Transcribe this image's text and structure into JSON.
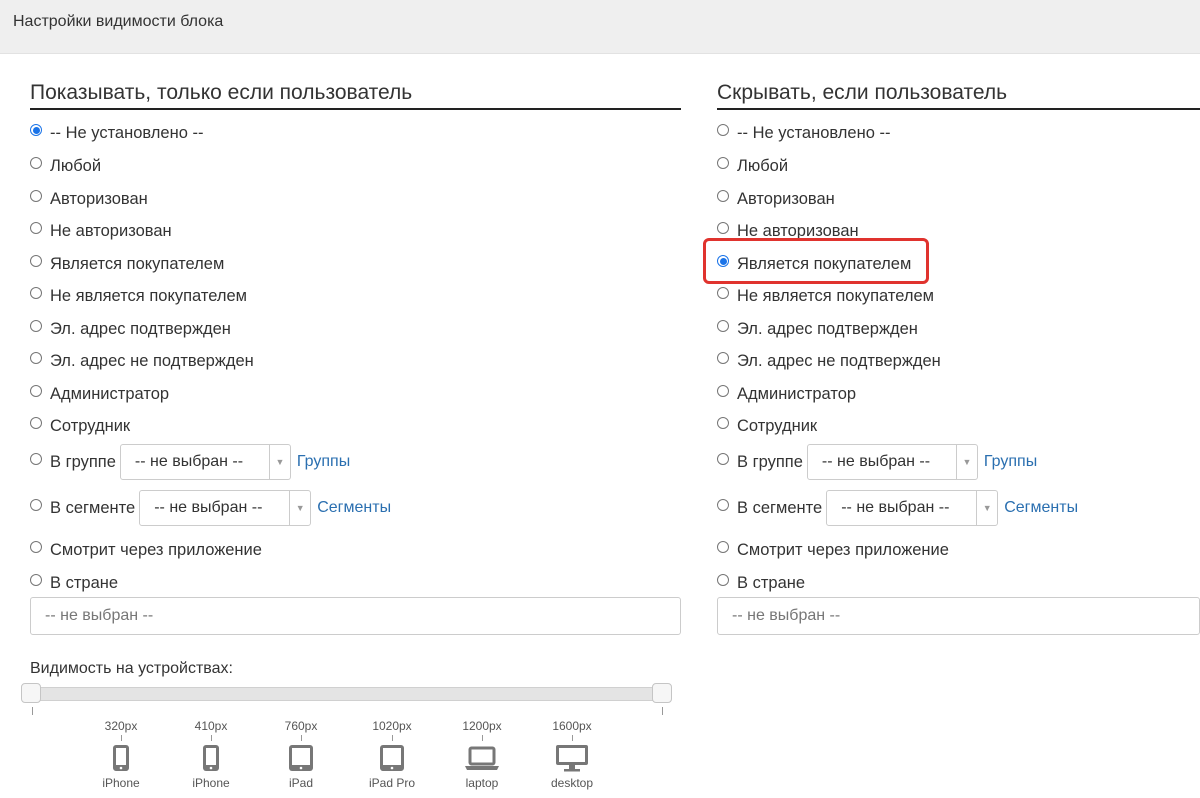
{
  "header": {
    "title": "Настройки видимости блока"
  },
  "show": {
    "title": "Показывать, только если пользователь",
    "options": [
      "-- Не установлено --",
      "Любой",
      "Авторизован",
      "Не авторизован",
      "Является покупателем",
      "Не является покупателем",
      "Эл. адрес подтвержден",
      "Эл. адрес не подтвержден",
      "Администратор",
      "Сотрудник",
      "В группе",
      "В сегменте",
      "Смотрит через приложение",
      "В стране"
    ],
    "selected_index": 0,
    "group_select": "-- не выбран --",
    "group_link": "Группы",
    "segment_select": "-- не выбран --",
    "segment_link": "Сегменты",
    "country_placeholder": "-- не выбран --"
  },
  "hide": {
    "title": "Скрывать, если пользователь",
    "options": [
      "-- Не установлено --",
      "Любой",
      "Авторизован",
      "Не авторизован",
      "Является покупателем",
      "Не является покупателем",
      "Эл. адрес подтвержден",
      "Эл. адрес не подтвержден",
      "Администратор",
      "Сотрудник",
      "В группе",
      "В сегменте",
      "Смотрит через приложение",
      "В стране"
    ],
    "selected_index": 4,
    "group_select": "-- не выбран --",
    "group_link": "Группы",
    "segment_select": "-- не выбран --",
    "segment_link": "Сегменты",
    "country_placeholder": "-- не выбран --"
  },
  "devices": {
    "label": "Видимость на устройствах:",
    "range_min_fraction": 0,
    "range_max_fraction": 1,
    "items": [
      {
        "px": "320px",
        "name": "iPhone",
        "icon": "phone-icon"
      },
      {
        "px": "410px",
        "name": "iPhone",
        "icon": "phone-icon"
      },
      {
        "px": "760px",
        "name": "iPad",
        "icon": "tablet-icon"
      },
      {
        "px": "1020px",
        "name": "iPad Pro",
        "icon": "tablet-icon"
      },
      {
        "px": "1200px",
        "name": "laptop",
        "icon": "laptop-icon"
      },
      {
        "px": "1600px",
        "name": "desktop",
        "icon": "desktop-icon"
      }
    ]
  },
  "colors": {
    "accent": "#1a73e8",
    "link": "#2a6fb0",
    "highlight": "#e0332e"
  }
}
